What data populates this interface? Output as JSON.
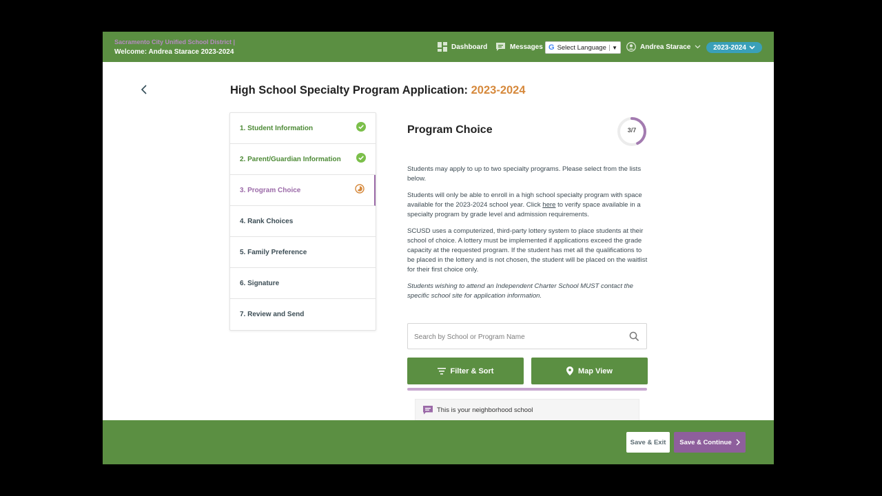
{
  "header": {
    "district": "Sacramento City Unified School District  |",
    "welcome": "Welcome: Andrea Starace 2023-2024",
    "dashboard_label": "Dashboard",
    "messages_label": "Messages",
    "language_label": "Select Language",
    "language_google_glyph": "G",
    "language_arrow": "▼",
    "user_name": "Andrea Starace",
    "year_label": "2023-2024"
  },
  "page": {
    "title": "High School Specialty Program Application:",
    "title_year": "2023-2024"
  },
  "steps": [
    {
      "label": "1. Student Information",
      "status": "complete"
    },
    {
      "label": "2. Parent/Guardian Information",
      "status": "complete"
    },
    {
      "label": "3. Program Choice",
      "status": "in-progress"
    },
    {
      "label": "4. Rank Choices",
      "status": "pending"
    },
    {
      "label": "5. Family Preference",
      "status": "pending"
    },
    {
      "label": "6. Signature",
      "status": "pending"
    },
    {
      "label": "7. Review and Send",
      "status": "pending"
    }
  ],
  "section": {
    "title": "Program Choice",
    "progress_label": "3/7",
    "progress_fraction": 0.4286,
    "para1": "Students may apply to up to two specialty programs. Please select from the lists below.",
    "para2_before": "Students will only be able to enroll in a high school specialty program with space available for the 2023-2024 school year. Click ",
    "para2_link": "here",
    "para2_after": " to verify space available in a specialty program by grade level and admission requirements.",
    "para3": "SCUSD uses a computerized, third-party lottery system to place students at their school of choice. A lottery must be implemented if applications exceed the grade capacity at the requested program. If the student has met all the qualifications to be placed in the lottery and is not chosen, the student will be placed on the waitlist for their first choice only.",
    "para4": "Students wishing to attend an Independent Charter School MUST contact the specific school site for application information."
  },
  "search": {
    "placeholder": "Search by School or Program Name",
    "value": ""
  },
  "buttons": {
    "filter_label": "Filter & Sort",
    "map_label": "Map View",
    "save_exit_label": "Save & Exit",
    "save_continue_label": "Save & Continue"
  },
  "note": {
    "text": "This is your neighborhood school"
  },
  "colors": {
    "brand_green": "#5b8f42",
    "accent_purple": "#8e5f9c",
    "year_orange": "#d6893c",
    "pill_teal": "#3aa0b9"
  }
}
